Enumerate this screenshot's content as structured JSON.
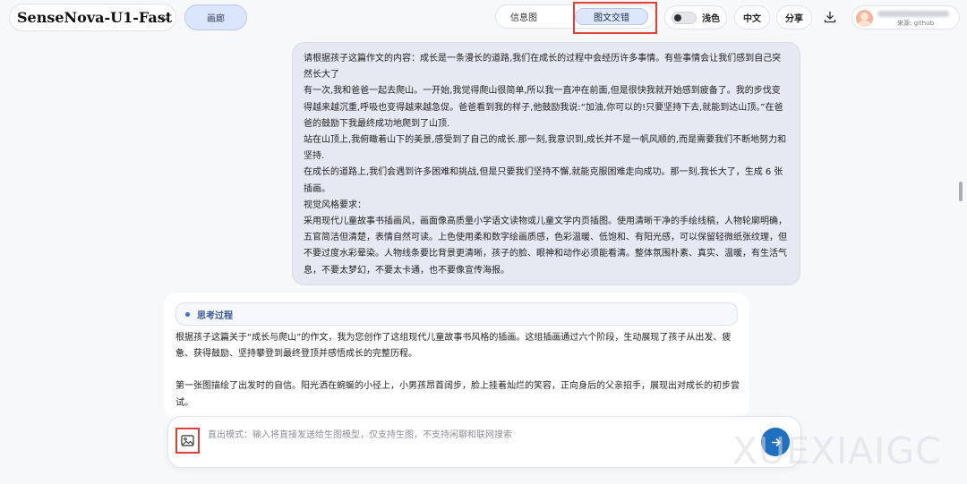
{
  "header": {
    "model_name": "SenseNova-U1-Fast",
    "gallery_label": "画廊",
    "mode_info_label": "信息图",
    "mode_interleave_label": "图文交错",
    "theme_label": "浅色",
    "lang_label": "中文",
    "share_label": "分享",
    "user_source": "来源: github"
  },
  "user_message": {
    "lines": [
      "请根据孩子这篇作文的内容：成长是一条漫长的道路,我们在成长的过程中会经历许多事情。有些事情会让我们感到自己突然长大了",
      "有一次,我和爸爸一起去爬山。一开始,我觉得爬山很简单,所以我一直冲在前面,但是很快我就开始感到疲备了。我的步伐变得越来越沉重,呼吸也变得越来越急促。爸爸看到我的样子,他鼓励我说:“加油,你可以的!只要坚持下去,就能到达山顶。”在爸爸的鼓励下我最终成功地爬到了山顶.",
      "站在山顶上,我俯瞰着山下的美景,感受到了自己的成长.那一刻,我意识到,成长并不是一帆风顺的,而是需要我们不断地努力和坚持.",
      "在成长的道路上,我们会遇到许多困难和挑战,但是只要我们坚持不懈,就能克服困难走向成功。那一刻,我长大了，生成 6 张插画。",
      "视觉风格要求：",
      "采用现代儿童故事书插画风，画面像高质量小学语文读物或儿童文学内页插图。使用清晰干净的手绘线稿，人物轮廓明确，五官简洁但清楚，表情自然可读。上色使用柔和数字绘画质感，色彩温暖、低饱和、有阳光感，可以保留轻微纸张纹理，但不要过度水彩晕染。人物线条要比背景更清晰，孩子的脸、眼神和动作必须能看清。整体氛围朴素、真实、温暖，有生活气息，不要太梦幻，不要太卡通，也不要像宣传海报。"
    ]
  },
  "assistant": {
    "thinking_label": "思考过程",
    "paragraphs": [
      "根据孩子这篇关于“成长与爬山”的作文，我为您创作了这组现代儿童故事书风格的插画。这组插画通过六个阶段，生动展现了孩子从出发、疲惫、获得鼓励、坚持攀登到最终登顶并感悟成长的完整历程。",
      "第一张图描绘了出发时的自信。阳光洒在蜿蜒的小径上，小男孩昂首阔步，脸上挂着灿烂的笑容，正向身后的父亲招手，展现出对成长的初步尝试。"
    ]
  },
  "input": {
    "placeholder": "直出模式：输入将直接发送给生图模型，仅支持生图，不支持闲聊和联网搜索",
    "value": ""
  },
  "watermark": "XUEXIAIGC",
  "colors": {
    "accent": "#1f6fc0",
    "highlight": "#e0403a",
    "user_bubble": "#e5e9f1"
  }
}
